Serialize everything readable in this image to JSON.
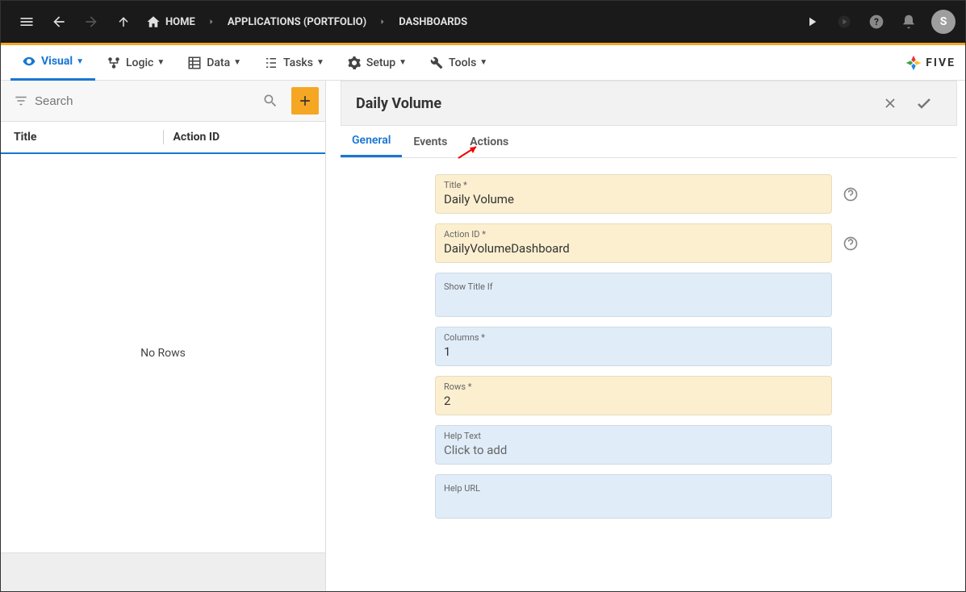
{
  "breadcrumb": {
    "home": "HOME",
    "applications": "APPLICATIONS (PORTFOLIO)",
    "dashboards": "DASHBOARDS"
  },
  "avatar_initial": "S",
  "brand": "FIVE",
  "mainTabs": [
    {
      "label": "Visual"
    },
    {
      "label": "Logic"
    },
    {
      "label": "Data"
    },
    {
      "label": "Tasks"
    },
    {
      "label": "Setup"
    },
    {
      "label": "Tools"
    }
  ],
  "search": {
    "placeholder": "Search"
  },
  "listCols": {
    "c1": "Title",
    "c2": "Action ID"
  },
  "noRows": "No Rows",
  "detail": {
    "title": "Daily Volume",
    "tabs": {
      "general": "General",
      "events": "Events",
      "actions": "Actions"
    },
    "fields": {
      "titleLabel": "Title *",
      "titleValue": "Daily Volume",
      "actionIdLabel": "Action ID *",
      "actionIdValue": "DailyVolumeDashboard",
      "showTitleIfLabel": "Show Title If",
      "showTitleIfValue": "",
      "columnsLabel": "Columns *",
      "columnsValue": "1",
      "rowsLabel": "Rows *",
      "rowsValue": "2",
      "helpTextLabel": "Help Text",
      "helpTextValue": "Click to add",
      "helpUrlLabel": "Help URL",
      "helpUrlValue": ""
    }
  }
}
